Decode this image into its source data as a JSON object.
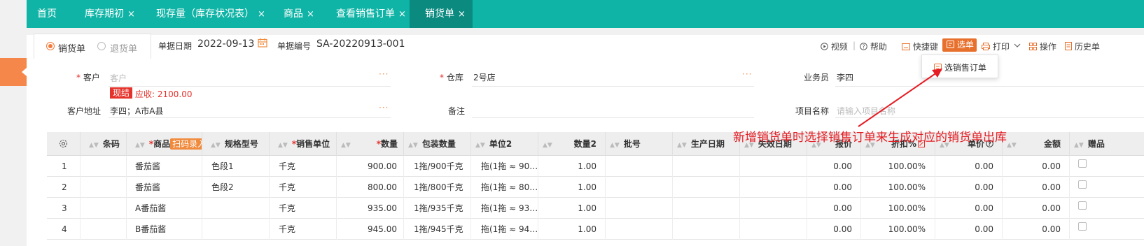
{
  "colors": {
    "teal": "#10b4a6",
    "teal_dark": "#0b8a80",
    "orange": "#e8702d",
    "red": "#e5322b"
  },
  "tabs": [
    {
      "label": "首页"
    },
    {
      "label": "库存期初"
    },
    {
      "label": "现存量（库存状况表）"
    },
    {
      "label": "商品"
    },
    {
      "label": "查看销售订单"
    },
    {
      "label": "销货单"
    }
  ],
  "close_glyph": "×",
  "doc_type": {
    "sale": "销货单",
    "return": "退货单"
  },
  "header": {
    "date_label": "单据日期",
    "date_value": "2022-09-13",
    "no_label": "单据编号",
    "no_value": "SA-20220913-001"
  },
  "toolbar": {
    "video": "视频",
    "help": "帮助",
    "shortcut": "快捷键",
    "select": "选单",
    "print": "打印",
    "operate": "操作",
    "history": "历史单"
  },
  "dropdown": {
    "item": "选销售订单"
  },
  "form": {
    "customer_label": "客户",
    "customer_placeholder": "客户",
    "cash_badge": "现结",
    "receivable": "应收: 2100.00",
    "address_label": "客户地址",
    "address_value": "李四；A市A县",
    "warehouse_label": "仓库",
    "warehouse_value": "2号店",
    "remark_label": "备注",
    "salesman_label": "业务员",
    "salesman_value": "李四",
    "project_label": "项目名称",
    "project_placeholder": "请输入项目名称",
    "dots": "···"
  },
  "annotation": "新增销货单时选择销售订单来生成对应的销货单出库",
  "table": {
    "columns": {
      "barcode": "条码",
      "product": "商品",
      "scan": "扫码录入",
      "spec": "规格型号",
      "unit": "销售单位",
      "qty": "数量",
      "pack_qty": "包装数量",
      "unit2": "单位2",
      "qty2": "数量2",
      "batch": "批号",
      "mfg": "生产日期",
      "exp": "失效日期",
      "quote": "报价",
      "discount": "折扣%",
      "price": "单价",
      "amount": "金额",
      "gift": "赠品"
    },
    "rows": [
      {
        "no": "1",
        "product": "番茄酱",
        "spec": "色段1",
        "unit": "千克",
        "qty": "900.00",
        "pack_qty": "1拖/900千克",
        "unit2": "拖(1拖 ≈ 90…",
        "qty2": "1.00",
        "quote": "0.00",
        "discount": "100.00%",
        "price": "0.00",
        "amount": "0.00"
      },
      {
        "no": "2",
        "product": "番茄酱",
        "spec": "色段2",
        "unit": "千克",
        "qty": "800.00",
        "pack_qty": "1拖/800千克",
        "unit2": "拖(1拖 ≈ 80…",
        "qty2": "1.00",
        "quote": "0.00",
        "discount": "100.00%",
        "price": "0.00",
        "amount": "0.00"
      },
      {
        "no": "3",
        "product": "A番茄酱",
        "spec": "",
        "unit": "千克",
        "qty": "935.00",
        "pack_qty": "1拖/935千克",
        "unit2": "拖(1拖 ≈ 93…",
        "qty2": "1.00",
        "quote": "0.00",
        "discount": "100.00%",
        "price": "0.00",
        "amount": "0.00"
      },
      {
        "no": "4",
        "product": "B番茄酱",
        "spec": "",
        "unit": "千克",
        "qty": "945.00",
        "pack_qty": "1拖/945千克",
        "unit2": "拖(1拖 ≈ 94…",
        "qty2": "1.00",
        "quote": "0.00",
        "discount": "100.00%",
        "price": "0.00",
        "amount": "0.00"
      }
    ]
  }
}
